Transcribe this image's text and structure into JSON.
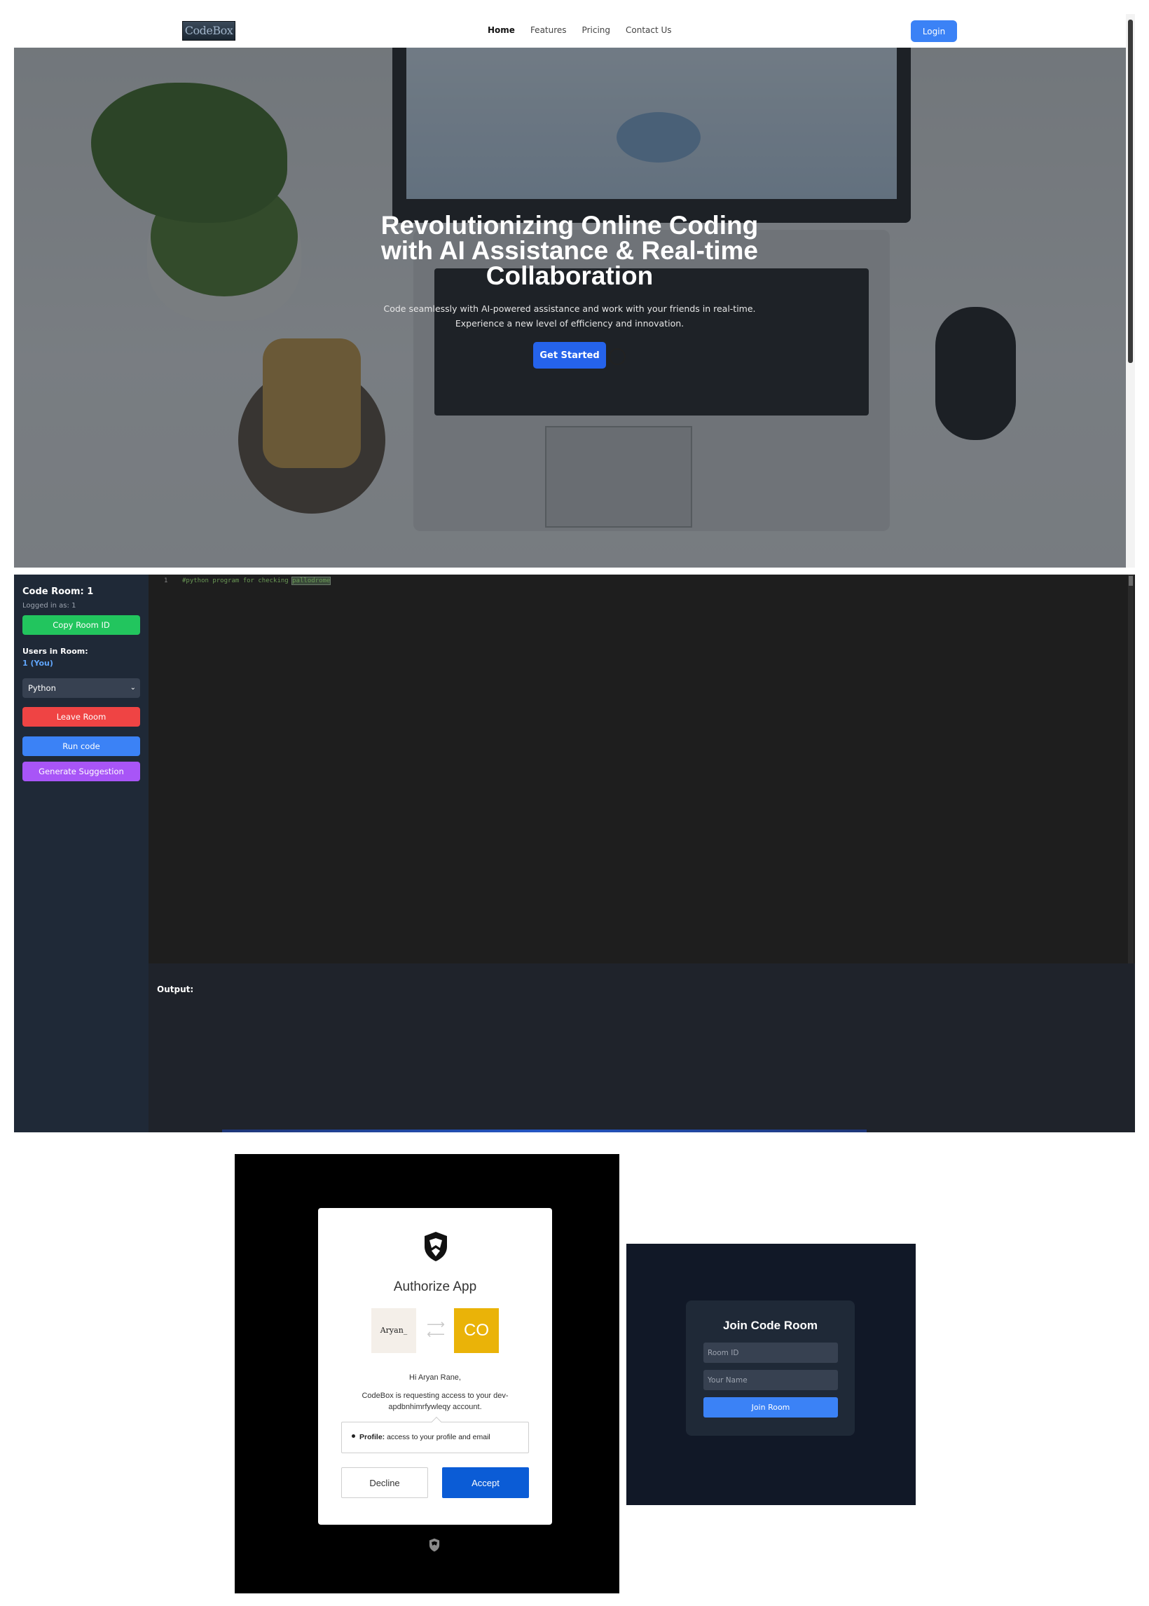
{
  "landing": {
    "logo_text": "CodeBox",
    "nav": {
      "links": [
        {
          "label": "Home",
          "active": true
        },
        {
          "label": "Features",
          "active": false
        },
        {
          "label": "Pricing",
          "active": false
        },
        {
          "label": "Contact Us",
          "active": false
        }
      ],
      "login_label": "Login"
    },
    "hero": {
      "title": "Revolutionizing Online Coding with AI Assistance & Real-time Collaboration",
      "subtitle": "Code seamlessly with AI-powered assistance and work with your friends in real-time. Experience a new level of efficiency and innovation.",
      "cta_label": "Get Started"
    },
    "colors": {
      "accent": "#3b82f6",
      "cta": "#2563eb"
    }
  },
  "coderoom": {
    "title": "Code Room: 1",
    "logged_in": "Logged in as: 1",
    "copy_label": "Copy Room ID",
    "users_label": "Users in Room:",
    "users_value": "1 (You)",
    "language": "Python",
    "leave_label": "Leave Room",
    "run_label": "Run code",
    "suggest_label": "Generate Suggestion",
    "editor": {
      "line_number": "1",
      "code_prefix": "#python program for checking ",
      "code_selected": "pallodrome"
    },
    "output_label": "Output:",
    "colors": {
      "copy": "#22c55e",
      "leave": "#ef4444",
      "run": "#3b82f6",
      "suggest": "#a855f7",
      "sidebar": "#1f2937",
      "editor": "#1e1e1e"
    }
  },
  "authorize": {
    "title": "Authorize App",
    "left_app_name": "Aryan_",
    "right_app_initials": "CO",
    "greeting": "Hi Aryan Rane,",
    "request": "CodeBox is requesting access to your dev-apdbnhimrfywleqy account.",
    "scope_name": "Profile:",
    "scope_desc": "access to your profile and email",
    "decline_label": "Decline",
    "accept_label": "Accept",
    "icons": [
      "shield-icon",
      "swap-arrows-icon"
    ],
    "colors": {
      "accept": "#0b5cd6",
      "tile": "#eab308"
    }
  },
  "join": {
    "title": "Join Code Room",
    "room_id_placeholder": "Room ID",
    "name_placeholder": "Your Name",
    "join_label": "Join Room",
    "colors": {
      "panel": "#111827",
      "card": "#1f2937",
      "button": "#3b82f6"
    }
  }
}
